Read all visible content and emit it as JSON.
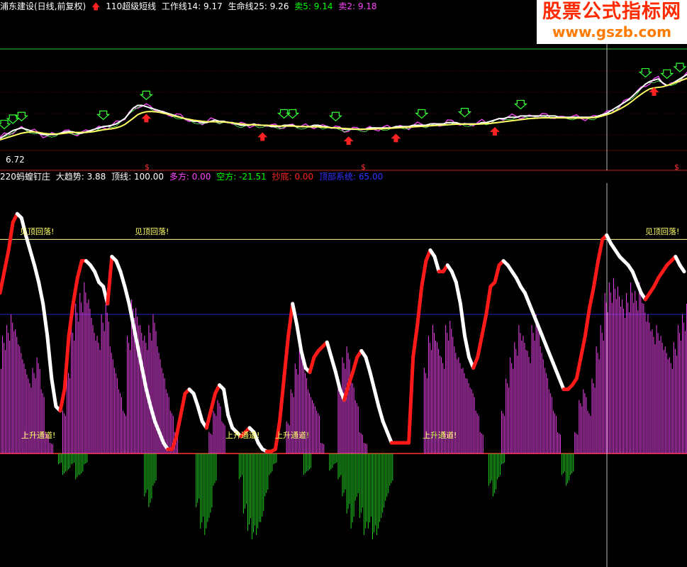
{
  "top_panel": {
    "stock_name": "浦东建设(日线,前复权)",
    "indicator_name": "110超级短线",
    "items": [
      {
        "label": "工作线14: 9.17",
        "color": "#ffffff"
      },
      {
        "label": "生命线25: 9.26",
        "color": "#ffffff"
      },
      {
        "label": "卖5: 9.14",
        "color": "#00ff00"
      },
      {
        "label": "卖2: 9.18",
        "color": "#ff44ff"
      }
    ],
    "low_label": "6.72",
    "dollar_marker": "$"
  },
  "bottom_panel": {
    "indicator_name": "220蚂蝗钉庄",
    "items": [
      {
        "label": "大趋势: 3.88",
        "color": "#ffffff"
      },
      {
        "label": "顶线: 100.00",
        "color": "#ffffff"
      },
      {
        "label": "多方: 0.00",
        "color": "#ff44ff"
      },
      {
        "label": "空方: -21.51",
        "color": "#00ff00"
      },
      {
        "label": "抄底: 0.00",
        "color": "#ff2222"
      },
      {
        "label": "顶部系统: 65.00",
        "color": "#3333ff"
      }
    ],
    "annotation_top": "见顶回落!",
    "annotation_up": "上升通道!"
  },
  "watermark": {
    "line1": "股票公式指标网",
    "line2": "www.gszb.com"
  },
  "chart_data": [
    {
      "type": "line",
      "title": "110超级短线",
      "x_count": 160,
      "ylim": [
        6.4,
        10.2
      ],
      "series": [
        {
          "name": "工作线14",
          "color": "#ffffff",
          "values": [
            6.85,
            6.95,
            7.05,
            7.15,
            7.2,
            7.25,
            7.2,
            7.15,
            7.1,
            7.05,
            7.0,
            7.0,
            7.0,
            7.0,
            7.05,
            7.1,
            7.12,
            7.1,
            7.05,
            7.05,
            7.1,
            7.15,
            7.2,
            7.25,
            7.3,
            7.32,
            7.35,
            7.4,
            7.5,
            7.6,
            7.8,
            8.0,
            8.1,
            8.1,
            8.05,
            8.0,
            7.95,
            7.9,
            7.85,
            7.8,
            7.75,
            7.7,
            7.65,
            7.6,
            7.55,
            7.5,
            7.5,
            7.45,
            7.45,
            7.5,
            7.55,
            7.5,
            7.5,
            7.45,
            7.45,
            7.4,
            7.35,
            7.35,
            7.35,
            7.4,
            7.35,
            7.35,
            7.35,
            7.3,
            7.3,
            7.3,
            7.35,
            7.35,
            7.35,
            7.3,
            7.3,
            7.3,
            7.3,
            7.35,
            7.35,
            7.3,
            7.3,
            7.25,
            7.25,
            7.25,
            7.2,
            7.2,
            7.2,
            7.2,
            7.2,
            7.2,
            7.25,
            7.25,
            7.25,
            7.25,
            7.25,
            7.25,
            7.3,
            7.3,
            7.3,
            7.3,
            7.35,
            7.35,
            7.35,
            7.35,
            7.4,
            7.4,
            7.4,
            7.4,
            7.45,
            7.45,
            7.45,
            7.4,
            7.4,
            7.4,
            7.4,
            7.4,
            7.45,
            7.45,
            7.5,
            7.55,
            7.6,
            7.6,
            7.65,
            7.65,
            7.65,
            7.7,
            7.7,
            7.7,
            7.7,
            7.7,
            7.7,
            7.7,
            7.7,
            7.7,
            7.65,
            7.65,
            7.65,
            7.65,
            7.65,
            7.65,
            7.65,
            7.65,
            7.65,
            7.7,
            7.75,
            7.8,
            7.9,
            8.0,
            8.1,
            8.2,
            8.3,
            8.45,
            8.6,
            8.75,
            8.9,
            9.0,
            9.05,
            9.1,
            8.95,
            8.85,
            8.9,
            9.0,
            9.1,
            9.2,
            9.3,
            9.35,
            9.4,
            9.17
          ]
        },
        {
          "name": "生命线25",
          "color": "#ffff66",
          "values": [
            6.8,
            6.85,
            6.9,
            6.95,
            7.0,
            7.05,
            7.08,
            7.1,
            7.1,
            7.08,
            7.05,
            7.03,
            7.02,
            7.02,
            7.03,
            7.05,
            7.07,
            7.08,
            7.08,
            7.08,
            7.08,
            7.1,
            7.12,
            7.15,
            7.18,
            7.2,
            7.22,
            7.25,
            7.3,
            7.38,
            7.5,
            7.62,
            7.75,
            7.82,
            7.86,
            7.87,
            7.86,
            7.84,
            7.8,
            7.77,
            7.72,
            7.68,
            7.64,
            7.6,
            7.57,
            7.54,
            7.52,
            7.5,
            7.48,
            7.48,
            7.48,
            7.48,
            7.47,
            7.46,
            7.44,
            7.42,
            7.4,
            7.38,
            7.37,
            7.37,
            7.36,
            7.35,
            7.35,
            7.34,
            7.33,
            7.32,
            7.32,
            7.32,
            7.32,
            7.31,
            7.3,
            7.3,
            7.29,
            7.29,
            7.29,
            7.28,
            7.27,
            7.26,
            7.25,
            7.24,
            7.23,
            7.22,
            7.21,
            7.2,
            7.2,
            7.2,
            7.2,
            7.21,
            7.22,
            7.22,
            7.23,
            7.24,
            7.25,
            7.26,
            7.27,
            7.28,
            7.29,
            7.3,
            7.31,
            7.32,
            7.33,
            7.34,
            7.35,
            7.36,
            7.37,
            7.38,
            7.39,
            7.39,
            7.39,
            7.39,
            7.39,
            7.39,
            7.4,
            7.41,
            7.42,
            7.44,
            7.46,
            7.48,
            7.5,
            7.52,
            7.54,
            7.56,
            7.58,
            7.6,
            7.61,
            7.62,
            7.63,
            7.63,
            7.63,
            7.63,
            7.63,
            7.63,
            7.62,
            7.62,
            7.62,
            7.62,
            7.62,
            7.63,
            7.64,
            7.66,
            7.7,
            7.75,
            7.8,
            7.88,
            7.96,
            8.05,
            8.15,
            8.27,
            8.4,
            8.52,
            8.63,
            8.72,
            8.76,
            8.78,
            8.8,
            8.85,
            8.9,
            8.96,
            9.02,
            9.08,
            9.14,
            9.26
          ]
        }
      ]
    },
    {
      "type": "bar",
      "title": "220蚂蝗钉庄",
      "x_count": 160,
      "ylim": [
        -50,
        125
      ],
      "zero_line": 0,
      "top_line": 100,
      "series": [
        {
          "name": "多方",
          "color": "#ee44ee",
          "values": [
            45,
            55,
            60,
            65,
            58,
            50,
            42,
            35,
            40,
            45,
            30,
            10,
            5,
            0,
            0,
            20,
            40,
            60,
            70,
            75,
            80,
            72,
            60,
            55,
            65,
            70,
            50,
            40,
            30,
            20,
            55,
            72,
            68,
            60,
            55,
            60,
            65,
            50,
            40,
            30,
            20,
            10,
            0,
            0,
            0,
            0,
            0,
            0,
            0,
            10,
            20,
            25,
            15,
            0,
            0,
            0,
            0,
            0,
            0,
            0,
            0,
            0,
            0,
            0,
            0,
            0,
            0,
            15,
            30,
            42,
            50,
            40,
            30,
            25,
            20,
            5,
            0,
            0,
            0,
            30,
            45,
            50,
            35,
            25,
            10,
            5,
            0,
            0,
            0,
            0,
            0,
            0,
            0,
            0,
            0,
            0,
            0,
            0,
            0,
            40,
            55,
            60,
            52,
            45,
            60,
            62,
            50,
            45,
            40,
            35,
            30,
            20,
            10,
            0,
            0,
            0,
            0,
            20,
            35,
            45,
            52,
            60,
            55,
            48,
            60,
            65,
            50,
            40,
            30,
            20,
            10,
            0,
            0,
            0,
            10,
            25,
            30,
            20,
            35,
            50,
            60,
            75,
            80,
            82,
            78,
            72,
            75,
            80,
            76,
            80,
            70,
            65,
            58,
            60,
            55,
            50,
            45,
            52,
            60,
            65,
            70,
            72
          ]
        },
        {
          "name": "空方",
          "color": "#22cc22",
          "values": [
            0,
            0,
            0,
            0,
            0,
            0,
            0,
            0,
            0,
            0,
            0,
            0,
            0,
            0,
            -5,
            -10,
            -8,
            -5,
            -12,
            -10,
            -5,
            0,
            0,
            0,
            0,
            0,
            0,
            0,
            0,
            0,
            0,
            0,
            0,
            0,
            -20,
            -25,
            -15,
            0,
            0,
            0,
            0,
            0,
            0,
            0,
            0,
            0,
            -25,
            -35,
            -38,
            -30,
            -15,
            0,
            0,
            0,
            0,
            0,
            -12,
            -28,
            -36,
            -40,
            -38,
            -32,
            -20,
            -10,
            -5,
            0,
            0,
            0,
            0,
            0,
            0,
            -10,
            -8,
            0,
            0,
            0,
            0,
            -8,
            -5,
            -12,
            -20,
            -28,
            -35,
            -22,
            -30,
            -38,
            -35,
            -40,
            -38,
            -30,
            -22,
            -15,
            0,
            0,
            0,
            0,
            0,
            0,
            0,
            0,
            0,
            0,
            0,
            0,
            0,
            0,
            0,
            0,
            0,
            0,
            0,
            0,
            0,
            0,
            -15,
            -20,
            -12,
            -5,
            0,
            0,
            0,
            0,
            0,
            0,
            0,
            0,
            0,
            0,
            0,
            0,
            0,
            -10,
            -15,
            -10,
            0,
            0,
            0,
            0,
            0,
            0,
            0,
            0,
            0,
            0,
            0,
            0,
            0,
            0,
            0,
            0,
            0,
            0,
            0,
            0,
            0,
            0,
            0,
            0,
            0
          ]
        },
        {
          "name": "大趋势",
          "color": "#ffffff",
          "values": [
            75,
            85,
            95,
            108,
            112,
            110,
            102,
            95,
            88,
            80,
            70,
            55,
            35,
            22,
            20,
            30,
            55,
            70,
            82,
            90,
            90,
            88,
            85,
            80,
            78,
            70,
            92,
            90,
            85,
            78,
            70,
            60,
            50,
            40,
            30,
            22,
            15,
            10,
            5,
            2,
            2,
            8,
            18,
            28,
            30,
            28,
            22,
            15,
            12,
            20,
            28,
            32,
            30,
            18,
            12,
            10,
            8,
            10,
            12,
            10,
            5,
            2,
            1,
            1,
            2,
            15,
            35,
            55,
            70,
            60,
            48,
            40,
            38,
            45,
            48,
            50,
            52,
            45,
            38,
            30,
            25,
            32,
            38,
            45,
            48,
            45,
            38,
            30,
            22,
            15,
            10,
            5,
            5,
            5,
            5,
            5,
            45,
            60,
            78,
            90,
            95,
            92,
            85,
            85,
            88,
            85,
            80,
            70,
            55,
            45,
            40,
            45,
            55,
            65,
            78,
            80,
            88,
            90,
            88,
            85,
            82,
            78,
            75,
            70,
            65,
            60,
            55,
            50,
            45,
            40,
            35,
            30,
            30,
            32,
            35,
            45,
            55,
            68,
            78,
            90,
            100,
            102,
            98,
            95,
            92,
            90,
            88,
            85,
            80,
            75,
            72,
            75,
            78,
            82,
            85,
            88,
            90,
            92,
            88,
            85
          ]
        }
      ]
    }
  ]
}
